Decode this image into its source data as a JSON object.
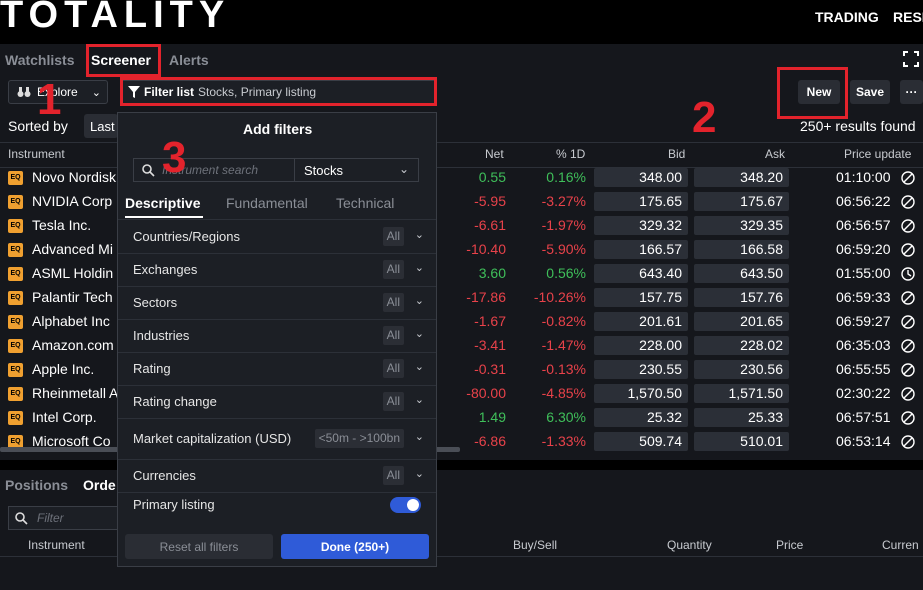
{
  "brand": {
    "logo": "TOTALITY"
  },
  "topnav": {
    "trading": "TRADING",
    "research": "RESE"
  },
  "tabs": {
    "watchlists": "Watchlists",
    "screener": "Screener",
    "alerts": "Alerts"
  },
  "toolbar": {
    "explore": "Explore",
    "filter_label": "Filter list",
    "filter_value": "Stocks, Primary listing",
    "new": "New",
    "save": "Save",
    "more": "···"
  },
  "sorted": {
    "label": "Sorted by",
    "value": "Last"
  },
  "results": "250+ results found",
  "columns": {
    "instrument": "Instrument",
    "net": "Net",
    "pct": "% 1D",
    "bid": "Bid",
    "ask": "Ask",
    "update": "Price update"
  },
  "rows": [
    {
      "name": "Novo Nordisk",
      "net": "0.55",
      "pct": "0.16%",
      "bid": "348.00",
      "ask": "348.20",
      "time": "01:10:00",
      "dir": "pos",
      "icon": "slash"
    },
    {
      "name": "NVIDIA Corp",
      "net": "-5.95",
      "pct": "-3.27%",
      "bid": "175.65",
      "ask": "175.67",
      "time": "06:56:22",
      "dir": "neg",
      "icon": "slash"
    },
    {
      "name": "Tesla Inc.",
      "net": "-6.61",
      "pct": "-1.97%",
      "bid": "329.32",
      "ask": "329.35",
      "time": "06:56:57",
      "dir": "neg",
      "icon": "slash"
    },
    {
      "name": "Advanced Mi",
      "net": "-10.40",
      "pct": "-5.90%",
      "bid": "166.57",
      "ask": "166.58",
      "time": "06:59:20",
      "dir": "neg",
      "icon": "slash"
    },
    {
      "name": "ASML Holdin",
      "net": "3.60",
      "pct": "0.56%",
      "bid": "643.40",
      "ask": "643.50",
      "time": "01:55:00",
      "dir": "pos",
      "icon": "clock"
    },
    {
      "name": "Palantir Tech",
      "net": "-17.86",
      "pct": "-10.26%",
      "bid": "157.75",
      "ask": "157.76",
      "time": "06:59:33",
      "dir": "neg",
      "icon": "slash"
    },
    {
      "name": "Alphabet Inc",
      "net": "-1.67",
      "pct": "-0.82%",
      "bid": "201.61",
      "ask": "201.65",
      "time": "06:59:27",
      "dir": "neg",
      "icon": "slash"
    },
    {
      "name": "Amazon.com",
      "net": "-3.41",
      "pct": "-1.47%",
      "bid": "228.00",
      "ask": "228.02",
      "time": "06:35:03",
      "dir": "neg",
      "icon": "slash"
    },
    {
      "name": "Apple Inc.",
      "net": "-0.31",
      "pct": "-0.13%",
      "bid": "230.55",
      "ask": "230.56",
      "time": "06:55:55",
      "dir": "neg",
      "icon": "slash"
    },
    {
      "name": "Rheinmetall A",
      "net": "-80.00",
      "pct": "-4.85%",
      "bid": "1,570.50",
      "ask": "1,571.50",
      "time": "02:30:22",
      "dir": "neg",
      "icon": "slash"
    },
    {
      "name": "Intel Corp.",
      "net": "1.49",
      "pct": "6.30%",
      "bid": "25.32",
      "ask": "25.33",
      "time": "06:57:51",
      "dir": "pos",
      "icon": "slash"
    },
    {
      "name": "Microsoft Co",
      "net": "-6.86",
      "pct": "-1.33%",
      "bid": "509.74",
      "ask": "510.01",
      "time": "06:53:14",
      "dir": "neg",
      "icon": "slash"
    }
  ],
  "eq_badge": "EQ",
  "add_filters": {
    "title": "Add filters",
    "search_placeholder": "Instrument search",
    "asset_type": "Stocks",
    "tabs": [
      "Descriptive",
      "Fundamental",
      "Technical"
    ],
    "items": [
      {
        "label": "Countries/Regions",
        "value": "All"
      },
      {
        "label": "Exchanges",
        "value": "All"
      },
      {
        "label": "Sectors",
        "value": "All"
      },
      {
        "label": "Industries",
        "value": "All"
      },
      {
        "label": "Rating",
        "value": "All"
      },
      {
        "label": "Rating change",
        "value": "All"
      },
      {
        "label": "Market capitalization (USD)",
        "value": "<50m - >100bn"
      },
      {
        "label": "Currencies",
        "value": "All"
      }
    ],
    "primary_listing": "Primary listing",
    "reset": "Reset all filters",
    "done": "Done (250+)"
  },
  "bottom": {
    "positions": "Positions",
    "orders": "Orde",
    "filter_placeholder": "Filter",
    "cols": {
      "instrument": "Instrument",
      "buysell": "Buy/Sell",
      "quantity": "Quantity",
      "price": "Price",
      "current": "Curren"
    }
  },
  "annotations": {
    "one": "1",
    "two": "2",
    "three": "3"
  },
  "colors": {
    "positive": "#3fbf5a",
    "negative": "#e8424a",
    "annotation": "#e3232c",
    "primary_button": "#2f5bd8",
    "eq_badge": "#f0a030"
  }
}
